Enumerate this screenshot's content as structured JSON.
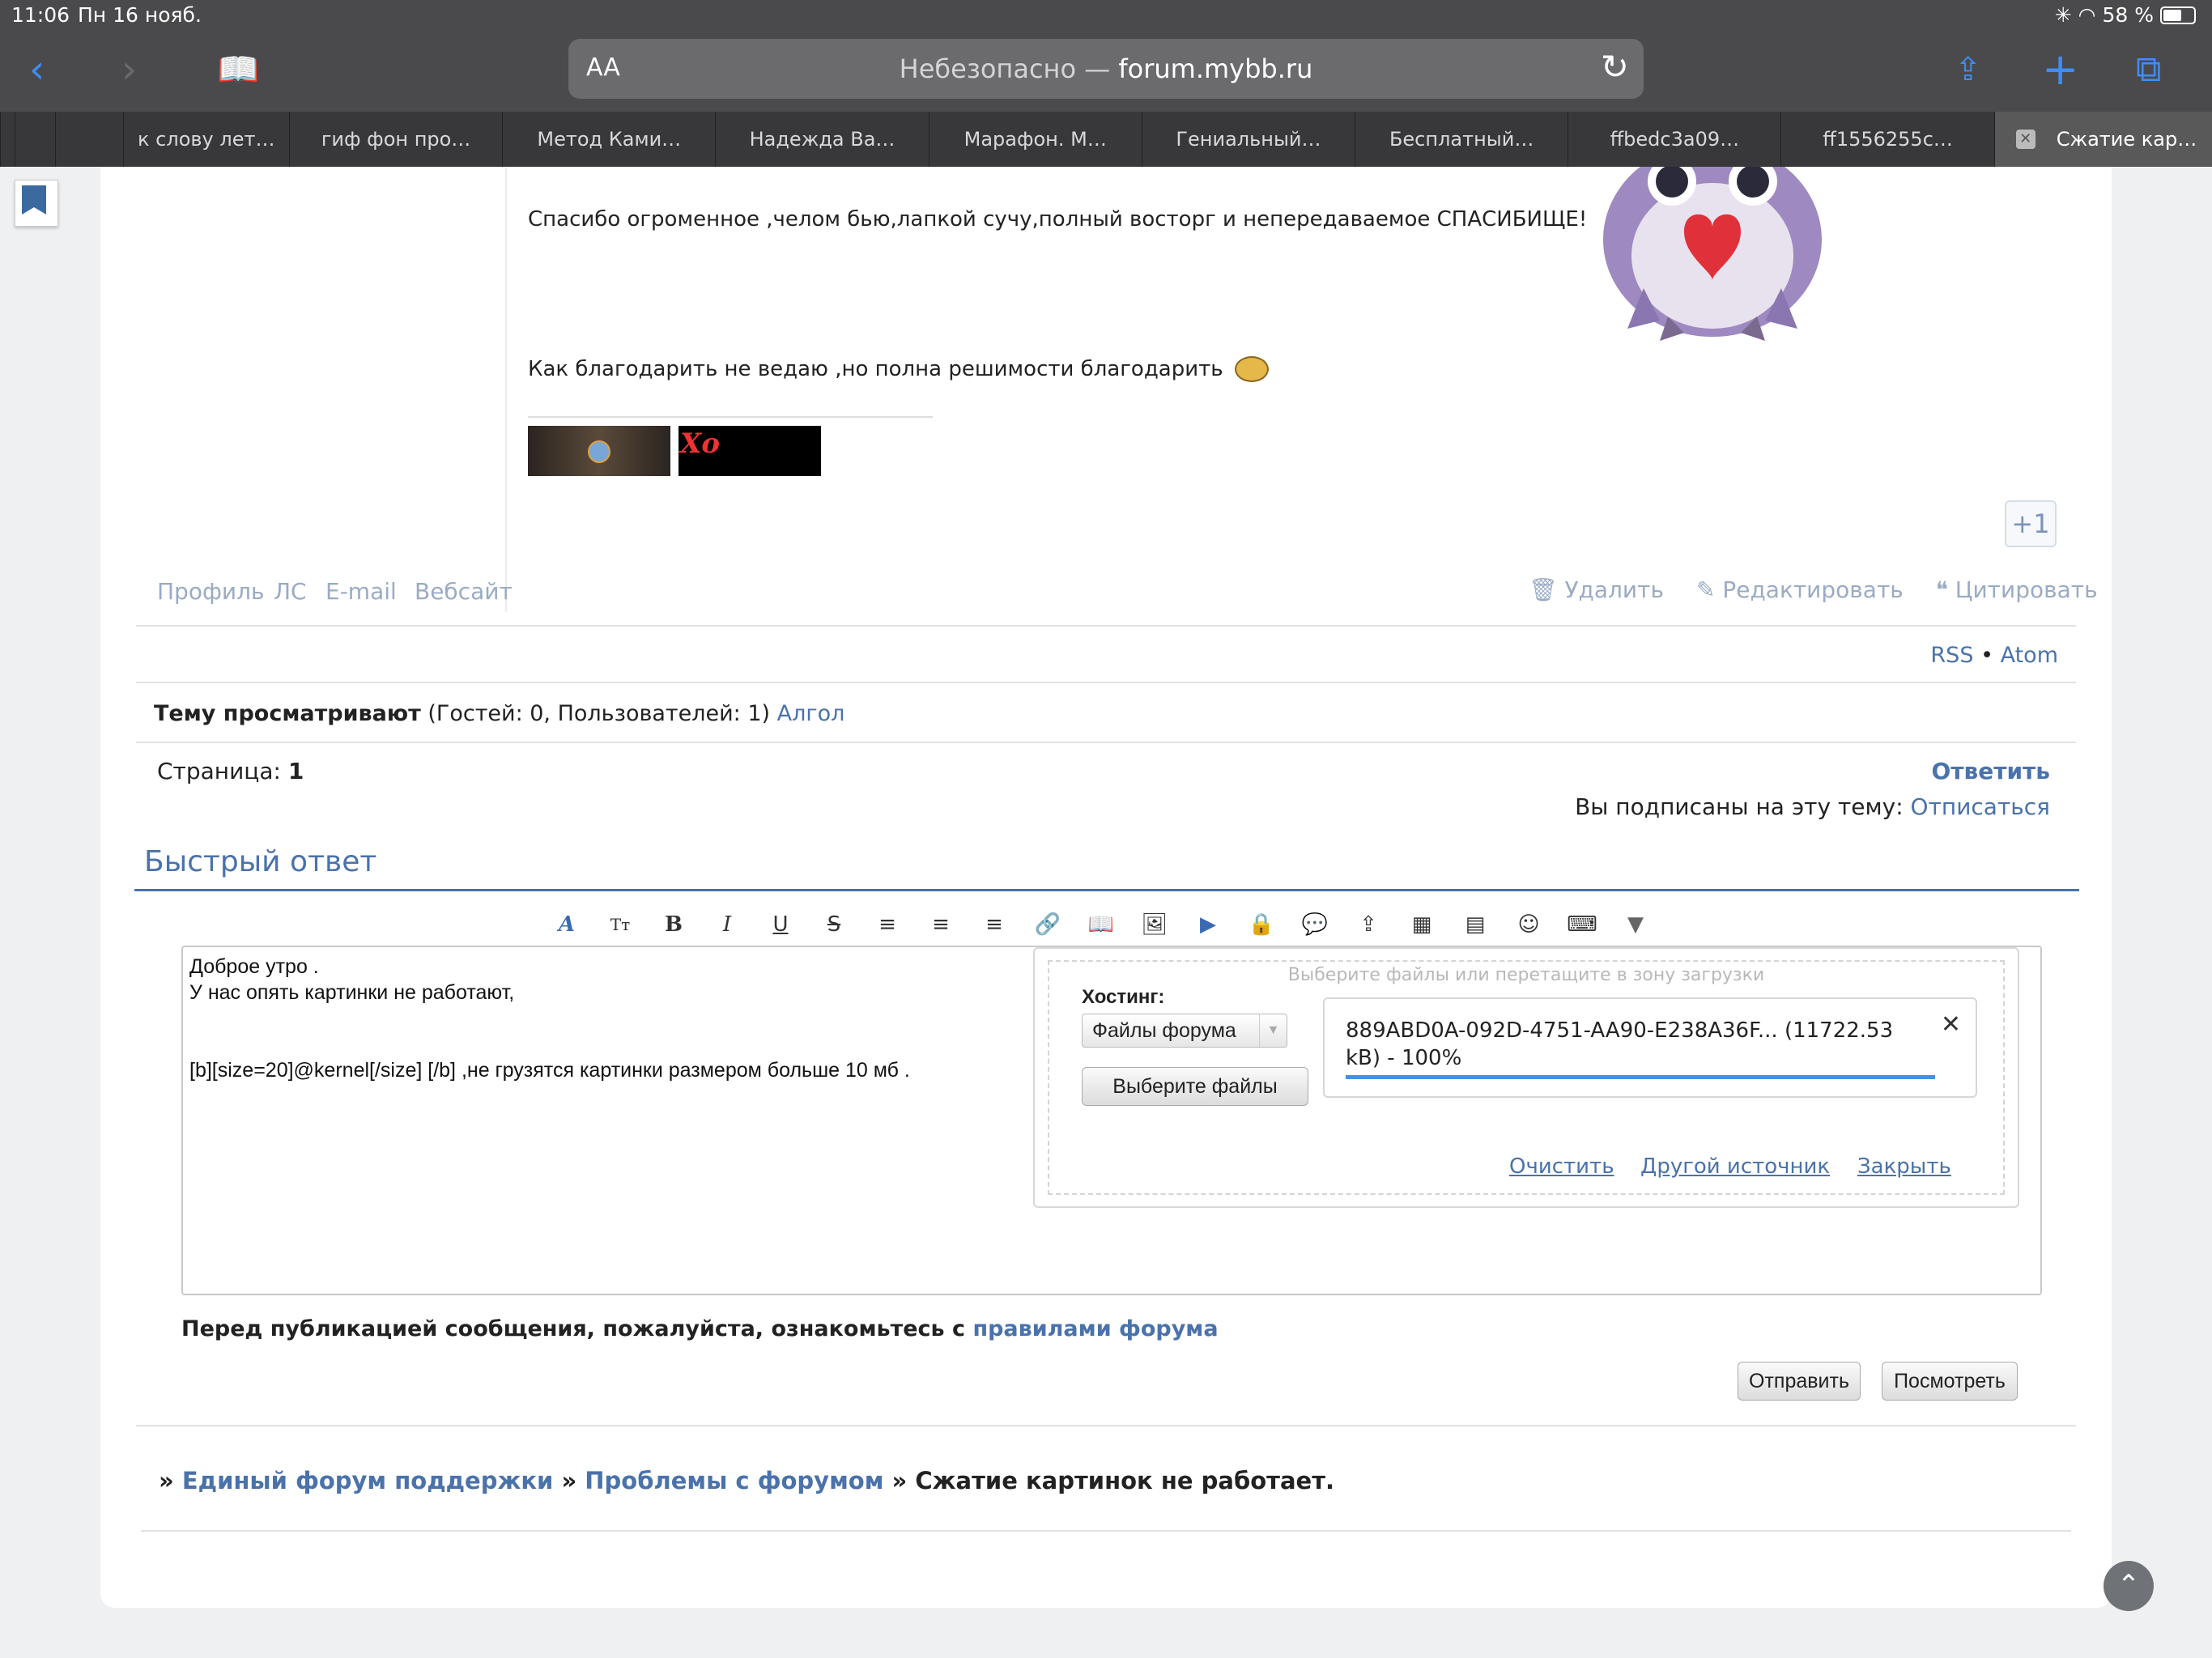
{
  "status": {
    "time": "11:06",
    "date": "Пн 16 нояб.",
    "battery": "58 %"
  },
  "browser": {
    "aa_label": "AA",
    "address_prefix": "Небезопасно — ",
    "address_domain": "forum.mybb.ru",
    "tabs": [
      "к слову лет…",
      "гиф фон про…",
      "Метод Ками…",
      "Надежда Ва…",
      "Марафон. М…",
      "Гениальный…",
      "Бесплатный…",
      "ffbedc3a09…",
      "ff1556255c…",
      "Сжатие кар…"
    ]
  },
  "post": {
    "line1": "Спасибо огроменное ,челом бью,лапкой сучу,полный восторг и непередаваемое СПАСИБИЩЕ!",
    "line2": "Как благодарить не ведаю ,но полна решимости благодарить",
    "plus_one": "+1",
    "author_links": [
      "Профиль",
      "ЛС",
      "E-mail",
      "Вебсайт"
    ],
    "actions": {
      "delete": "Удалить",
      "edit": "Редактировать",
      "quote": "Цитировать"
    }
  },
  "feeds": {
    "rss": "RSS",
    "sep": "•",
    "atom": "Atom"
  },
  "viewers": {
    "label": "Тему просматривают",
    "counts": "(Гостей: 0, Пользователей: 1)",
    "user": "Алгол"
  },
  "pagination": {
    "label": "Страница:",
    "page": "1"
  },
  "reply_link": "Ответить",
  "subscription": {
    "text": "Вы подписаны на эту тему:",
    "link": "Отписаться"
  },
  "quick_reply": {
    "title": "Быстрый ответ",
    "text": "Доброе утро .\nУ нас опять картинки не работают,\n\n\n[b][size=20]@kernel[/size] [/b] ,не грузятся картинки размером больше 10 мб ."
  },
  "upload": {
    "drop_hint": "Выберите файлы или перетащите в зону загрузки",
    "hosting_label": "Хостинг:",
    "hosting_value": "Файлы форума",
    "choose_button": "Выберите файлы",
    "file_name": "889ABD0A-092D-4751-AA90-E238A36F... (11722.53 kB) - 100%",
    "progress": 1.0,
    "clear": "Очистить",
    "other_source": "Другой источник",
    "close": "Закрыть"
  },
  "rules": {
    "text": "Перед публикацией сообщения, пожалуйста, ознакомьтесь с",
    "link": "правилами форума"
  },
  "buttons": {
    "send": "Отправить",
    "preview": "Посмотреть"
  },
  "breadcrumbs": {
    "sep": "»",
    "item1": "Единый форум поддержки",
    "item2": "Проблемы с форумом",
    "current": "Сжатие картинок не работает."
  },
  "colors": {
    "accent": "#4a72ab",
    "toolbar": "#4a4a4c",
    "tabbar": "#38383a",
    "ios_blue": "#3f8ef7"
  }
}
